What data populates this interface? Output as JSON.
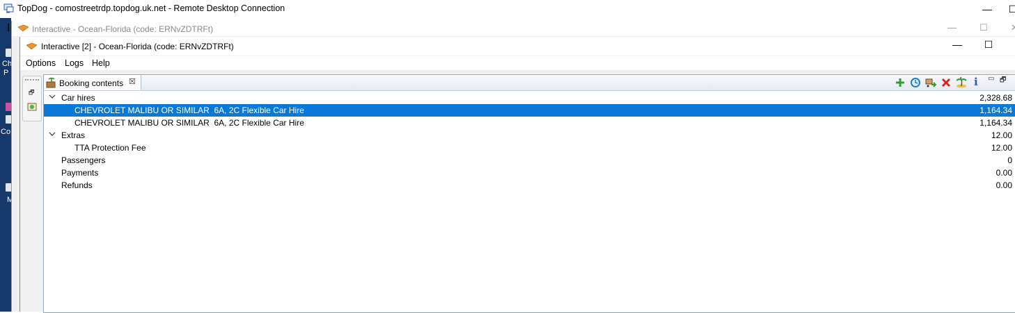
{
  "rdp": {
    "title": "TopDog - comostreetrdp.topdog.uk.net - Remote Desktop Connection",
    "minimize_glyph": "—",
    "maximize_glyph": "☐"
  },
  "desktop_fragments": {
    "a": "Ch",
    "b": "P",
    "c": "Co",
    "d": "M",
    "e": "I"
  },
  "background_window": {
    "title": "Interactive - Ocean-Florida (code: ERNvZDTRFt)",
    "minimize_glyph": "—",
    "maximize_glyph": "☐",
    "close_glyph": "✕"
  },
  "window": {
    "title": "Interactive [2] - Ocean-Florida (code: ERNvZDTRFt)",
    "minimize_glyph": "—",
    "maximize_glyph": "☐"
  },
  "menu": {
    "options": "Options",
    "logs": "Logs",
    "help": "Help"
  },
  "side_toolbar": {
    "restore_glyph": "🗗"
  },
  "view": {
    "tab_label": "Booking contents",
    "tab_close_glyph": "☒",
    "toolbar_icons": [
      "add-icon",
      "refresh-icon",
      "transfer-icon",
      "delete-icon",
      "island-icon",
      "info-icon"
    ],
    "info_glyph": "i",
    "minimize_glyph": "▭",
    "maximize_glyph": "🗗"
  },
  "tree": {
    "rows": [
      {
        "label": "Car hires",
        "amount": "2,328.68",
        "level": 0,
        "expanded": true
      },
      {
        "label": "CHEVROLET MALIBU OR SIMILAR  6A, 2C Flexible Car Hire",
        "amount": "1,164.34",
        "level": 1,
        "selected": true
      },
      {
        "label": "CHEVROLET MALIBU OR SIMILAR  6A, 2C Flexible Car Hire",
        "amount": "1,164.34",
        "level": 1
      },
      {
        "label": "Extras",
        "amount": "12.00",
        "level": 0,
        "expanded": true
      },
      {
        "label": "TTA Protection Fee",
        "amount": "12.00",
        "level": 1
      },
      {
        "label": "Passengers",
        "amount": "0",
        "level": 0
      },
      {
        "label": "Payments",
        "amount": "0.00",
        "level": 0
      },
      {
        "label": "Refunds",
        "amount": "0.00",
        "level": 0
      }
    ]
  },
  "colors": {
    "selection": "#0a78d7",
    "desktop": "#15396b"
  }
}
